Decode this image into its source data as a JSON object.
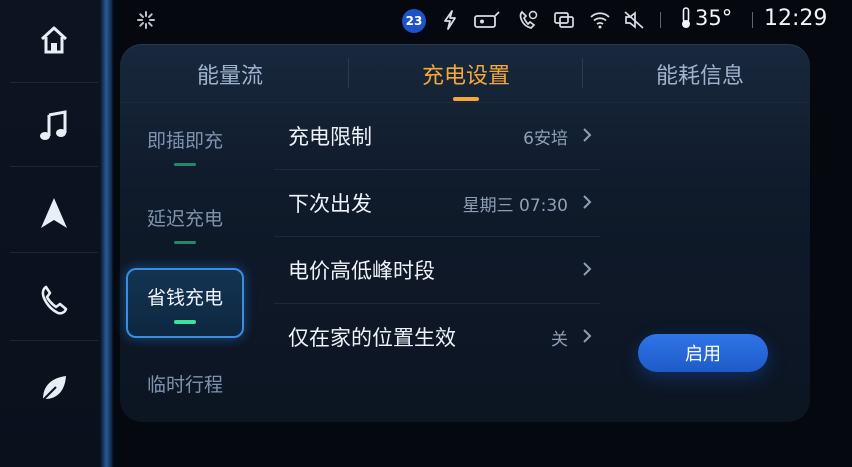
{
  "status_bar": {
    "notification_count": "23",
    "temperature": "35°",
    "time": "12:29",
    "icons": [
      "loader-icon",
      "charging-bolt-icon",
      "car-key-icon",
      "call-settings-icon",
      "screen-mirror-icon",
      "wifi-icon",
      "mute-icon",
      "thermometer-icon"
    ]
  },
  "rail": {
    "items": [
      "home-icon",
      "music-icon",
      "navigation-icon",
      "phone-icon",
      "leaf-icon"
    ]
  },
  "tabs": [
    {
      "label": "能量流"
    },
    {
      "label": "充电设置"
    },
    {
      "label": "能耗信息"
    }
  ],
  "active_tab": 1,
  "subnav": {
    "items": [
      {
        "label": "即插即充"
      },
      {
        "label": "延迟充电"
      },
      {
        "label": "省钱充电"
      },
      {
        "label": "临时行程"
      }
    ],
    "active_index": 2
  },
  "settings": [
    {
      "label": "充电限制",
      "value": "6安培"
    },
    {
      "label": "下次出发",
      "value": "星期三  07:30"
    },
    {
      "label": "电价高低峰时段",
      "value": ""
    },
    {
      "label": "仅在家的位置生效",
      "value": "关"
    }
  ],
  "enable_button": {
    "label": "启用"
  },
  "colors": {
    "accent_tab": "#f5a83a",
    "primary_button": "#2f74e8",
    "active_mark": "#3ee39a",
    "rail_glow": "#3c96ff"
  }
}
